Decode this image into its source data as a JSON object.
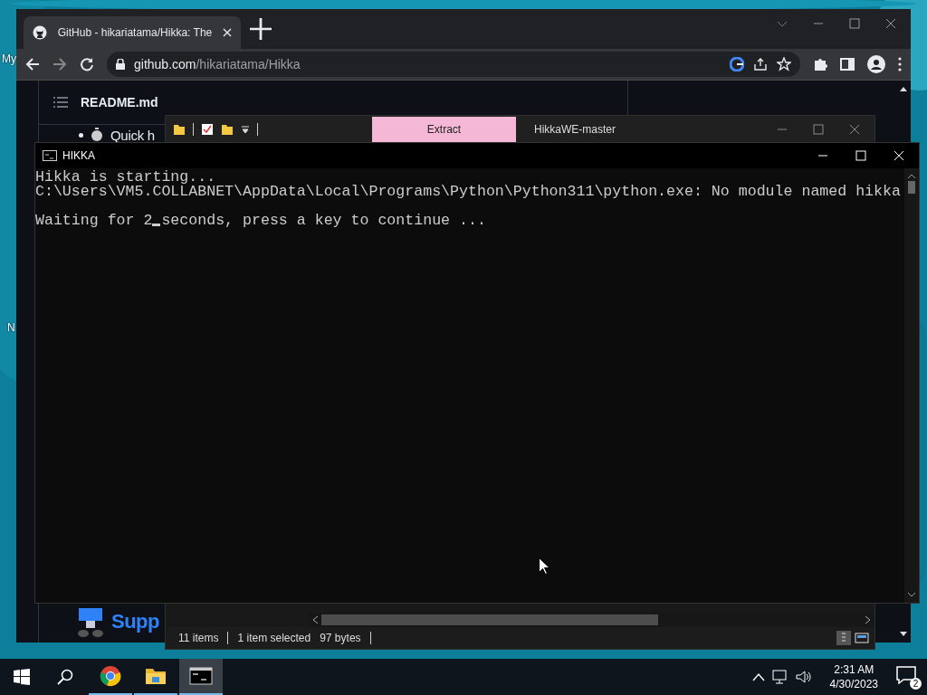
{
  "desktop": {
    "labels": [
      "My",
      "N"
    ]
  },
  "browser": {
    "tab_title": "GitHub - hikariatama/Hikka: The",
    "address": {
      "domain": "github.com",
      "path": "/hikariatama/Hikka"
    },
    "readme_title": "README.md",
    "list_item": "Quick h",
    "support_link": "Supp"
  },
  "explorer": {
    "ribbon_tab": "Extract",
    "title": "HikkaWE-master",
    "status": [
      "11 items",
      "1 item selected"
    ],
    "size": "97 bytes"
  },
  "console": {
    "title": "HIKKA",
    "lines": [
      "Hikka is starting...",
      "C:\\Users\\VM5.COLLABNET\\AppData\\Local\\Programs\\Python\\Python311\\python.exe: No module named hikka"
    ],
    "prompt": {
      "before": "Waiting for 2",
      "after": "seconds, press a key to continue ..."
    }
  },
  "taskbar": {
    "apps": [
      {
        "kind": "browser",
        "selected": false
      },
      {
        "kind": "folder",
        "selected": false
      },
      {
        "kind": "console",
        "selected": true
      }
    ],
    "time": "2:31 AM",
    "date": "4/30/2023",
    "notifications": "2"
  }
}
